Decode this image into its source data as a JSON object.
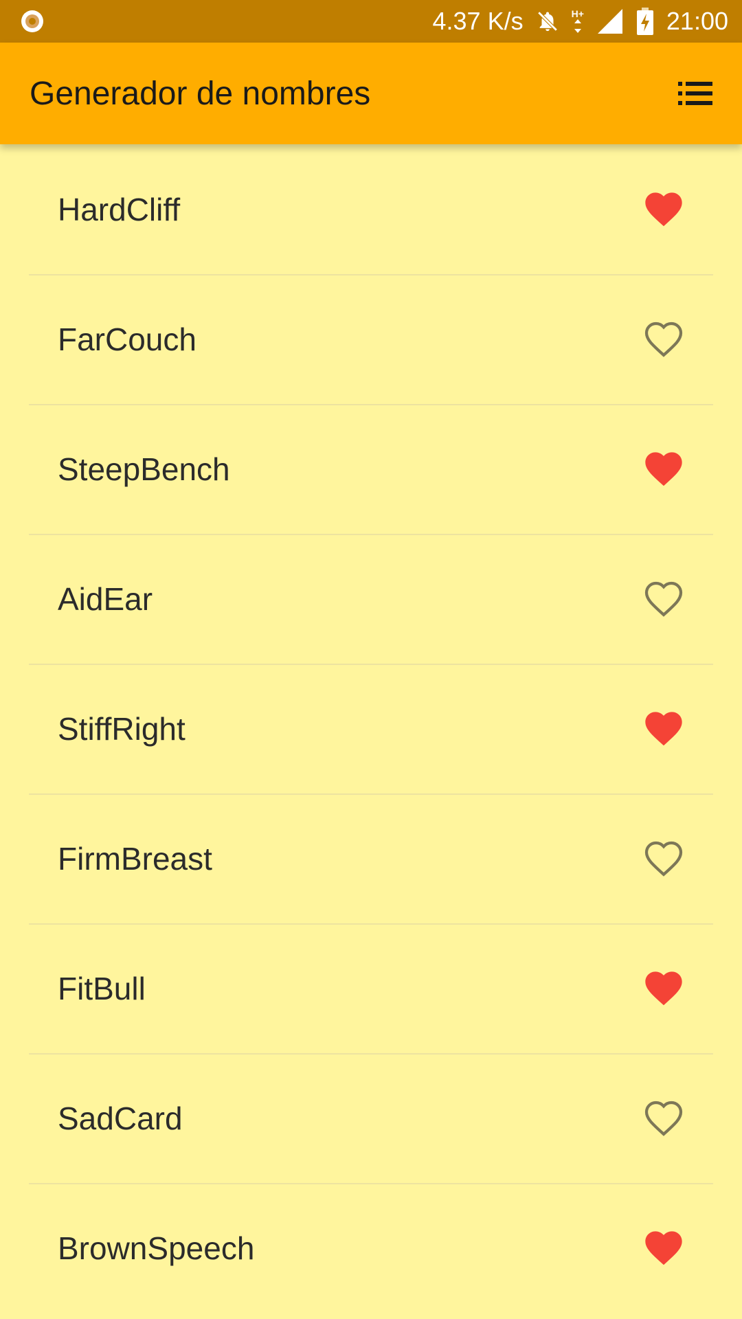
{
  "status_bar": {
    "net_speed": "4.37 K/s",
    "network_label": "H+",
    "time": "21:00",
    "icons": [
      "record-icon",
      "notifications-off-icon",
      "data-arrows-icon",
      "signal-icon",
      "battery-charging-icon"
    ]
  },
  "app_bar": {
    "title": "Generador de nombres",
    "action_icon": "list-icon"
  },
  "colors": {
    "status_bar": "#BF7E00",
    "app_bar": "#FFAD00",
    "background": "#FFF59D",
    "heart_filled": "#F44336",
    "heart_outline": "#7D7757"
  },
  "names": [
    {
      "label": "HardCliff",
      "saved": true
    },
    {
      "label": "FarCouch",
      "saved": false
    },
    {
      "label": "SteepBench",
      "saved": true
    },
    {
      "label": "AidEar",
      "saved": false
    },
    {
      "label": "StiffRight",
      "saved": true
    },
    {
      "label": "FirmBreast",
      "saved": false
    },
    {
      "label": "FitBull",
      "saved": true
    },
    {
      "label": "SadCard",
      "saved": false
    },
    {
      "label": "BrownSpeech",
      "saved": true
    }
  ]
}
